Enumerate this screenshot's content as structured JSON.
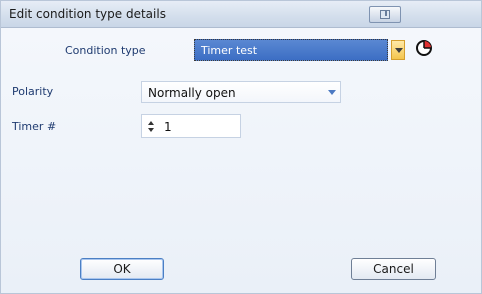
{
  "window": {
    "title": "Edit condition type details"
  },
  "form": {
    "condition_type": {
      "label": "Condition type",
      "value": "Timer test"
    },
    "polarity": {
      "label": "Polarity",
      "value": "Normally open"
    },
    "timer": {
      "label": "Timer #",
      "value": "1"
    }
  },
  "buttons": {
    "ok": "OK",
    "cancel": "Cancel"
  },
  "icons": {
    "title_button": "restore-window-icon",
    "condition_icon": "pie-chart-icon"
  },
  "colors": {
    "selection": "#3c6ec4",
    "dropdown_accent": "#f4c54d",
    "dialog_bg": "#eaf0f8"
  }
}
